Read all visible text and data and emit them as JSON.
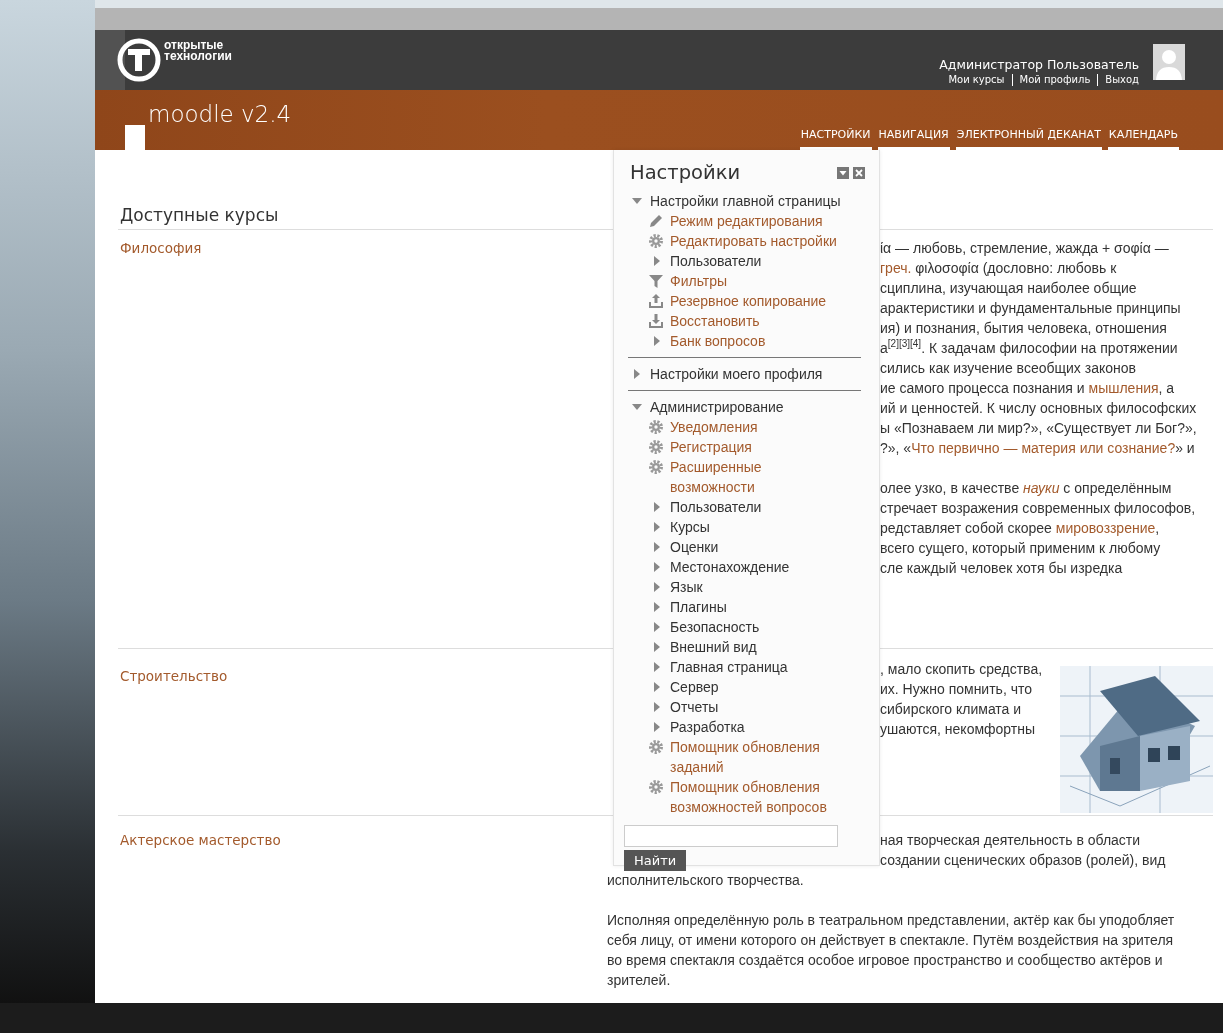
{
  "header": {
    "brand": {
      "line_1": "открытые",
      "line_2": "технологии"
    },
    "user": {
      "name": "Администратор Пользователь",
      "links": [
        "Мои курсы",
        "Мой профиль",
        "Выход"
      ]
    },
    "site_title": "moodle v2.4",
    "nav": [
      "НАСТРОЙКИ",
      "НАВИГАЦИЯ",
      "ЭЛЕКТРОННЫЙ ДЕКАНАТ",
      "КАЛЕНДАРЬ"
    ]
  },
  "courses": {
    "heading": "Доступные курсы",
    "items": [
      {
        "name": "Философия",
        "paragraphs": [
          [
            {
              "covered": true,
              "parts": [
                {
                  "text": "ία — любовь, стремление, жажда + σοφία —"
                }
              ]
            },
            {
              "covered": true,
              "parts": [
                {
                  "text": "греч.",
                  "link": true
                },
                {
                  "text": " φιλοσοφία (дословно: любовь к"
                }
              ]
            },
            {
              "covered": true,
              "parts": [
                {
                  "text": "сциплина, изучающая наиболее общие"
                }
              ]
            },
            {
              "covered": true,
              "parts": [
                {
                  "text": "арактеристики и фундаментальные принципы"
                }
              ]
            },
            {
              "covered": true,
              "parts": [
                {
                  "text": "ия) и познания, бытия человека, отношения"
                }
              ]
            },
            {
              "covered": true,
              "parts": [
                {
                  "text": "а$^{[2][3][4]}$. К задачам философии на протяжении"
                }
              ]
            },
            {
              "covered": true,
              "parts": [
                {
                  "text": "сились как изучение всеобщих законов"
                }
              ]
            },
            {
              "covered": true,
              "parts": [
                {
                  "text": "ие самого процесса познания и "
                },
                {
                  "text": "мышления",
                  "link": true
                },
                {
                  "text": ", а"
                }
              ]
            },
            {
              "covered": true,
              "parts": [
                {
                  "text": "ий и ценностей. К числу основных философских"
                }
              ]
            },
            {
              "covered": true,
              "parts": [
                {
                  "text": "ы «Познаваем ли мир?», «Существует ли Бог?»,"
                }
              ]
            },
            {
              "covered": true,
              "parts": [
                {
                  "text": "?», «"
                },
                {
                  "text": "Что первично — материя или сознание?",
                  "link": true
                },
                {
                  "text": "» и"
                }
              ]
            }
          ],
          [
            {
              "covered": true,
              "parts": [
                {
                  "text": "олее узко, в качестве "
                },
                {
                  "text": "*науки*",
                  "link": true
                },
                {
                  "text": " с определённым"
                }
              ]
            },
            {
              "covered": true,
              "parts": [
                {
                  "text": "стречает возражения современных философов,"
                }
              ]
            },
            {
              "covered": true,
              "parts": [
                {
                  "text": "редставляет собой скорее "
                },
                {
                  "text": "мировоззрение",
                  "link": true
                },
                {
                  "text": ","
                }
              ]
            },
            {
              "covered": true,
              "parts": [
                {
                  "text": "всего сущего, который применим к любому"
                }
              ]
            },
            {
              "covered": true,
              "parts": [
                {
                  "text": "сле каждый человек хотя бы изредка"
                }
              ]
            }
          ]
        ]
      },
      {
        "name": "Строительство",
        "image": {
          "kind": "picture"
        },
        "paragraphs": [
          [
            {
              "covered": true,
              "parts": [
                {
                  "text": ", мало скопить средства,"
                }
              ]
            },
            {
              "covered": true,
              "parts": [
                {
                  "text": "их. Нужно помнить, что"
                }
              ]
            },
            {
              "covered": true,
              "parts": [
                {
                  "text": "сибирского климата и"
                }
              ]
            },
            {
              "covered": true,
              "parts": [
                {
                  "text": "ушаются, некомфортны"
                }
              ]
            }
          ]
        ]
      },
      {
        "name": "Актерское мастерство",
        "paragraphs": [
          [
            {
              "covered": true,
              "parts": [
                {
                  "text": "ная творческая деятельность в области"
                }
              ]
            },
            {
              "covered": true,
              "parts": [
                {
                  "text": "создании сценических образов (ролей), вид"
                }
              ]
            },
            {
              "parts": [
                {
                  "text": "исполнительского творчества."
                }
              ]
            }
          ],
          [
            {
              "parts": [
                {
                  "text": "Исполняя определённую роль в театральном представлении, актёр как бы уподобляет"
                }
              ]
            },
            {
              "parts": [
                {
                  "text": "себя лицу, от имени которого он действует в спектакле. Путём воздействия на зрителя"
                }
              ]
            },
            {
              "parts": [
                {
                  "text": "во время спектакля создаётся особое игровое пространство и сообщество актёров и"
                }
              ]
            },
            {
              "parts": [
                {
                  "text": "зрителей."
                }
              ]
            }
          ]
        ]
      }
    ]
  },
  "settings_block": {
    "title": "Настройки",
    "tree": [
      {
        "kind": "branch",
        "label": "Настройки главной страницы",
        "expanded": true,
        "children": [
          {
            "kind": "pencil",
            "label": "Режим редактирования"
          },
          {
            "kind": "gear",
            "label": "Редактировать настройки"
          },
          {
            "kind": "branch",
            "label": "Пользователи",
            "expanded": false
          },
          {
            "kind": "filter",
            "label": "Фильтры"
          },
          {
            "kind": "upload",
            "label": "Резервное копирование"
          },
          {
            "kind": "download",
            "label": "Восстановить"
          },
          {
            "kind": "branch",
            "label": "Банк вопросов",
            "expanded": false,
            "link": true
          }
        ]
      },
      {
        "kind": "branch",
        "label": "Настройки моего профиля",
        "expanded": false
      },
      {
        "kind": "branch",
        "label": "Администрирование",
        "expanded": true,
        "children": [
          {
            "kind": "gear",
            "label": "Уведомления"
          },
          {
            "kind": "gear",
            "label": "Регистрация"
          },
          {
            "kind": "gear",
            "label": "Расширенные возможности"
          },
          {
            "kind": "branch",
            "label": "Пользователи",
            "expanded": false
          },
          {
            "kind": "branch",
            "label": "Курсы",
            "expanded": false
          },
          {
            "kind": "branch",
            "label": "Оценки",
            "expanded": false
          },
          {
            "kind": "branch",
            "label": "Местонахождение",
            "expanded": false
          },
          {
            "kind": "branch",
            "label": "Язык",
            "expanded": false
          },
          {
            "kind": "branch",
            "label": "Плагины",
            "expanded": false
          },
          {
            "kind": "branch",
            "label": "Безопасность",
            "expanded": false
          },
          {
            "kind": "branch",
            "label": "Внешний вид",
            "expanded": false
          },
          {
            "kind": "branch",
            "label": "Главная страница",
            "expanded": false
          },
          {
            "kind": "branch",
            "label": "Сервер",
            "expanded": false
          },
          {
            "kind": "branch",
            "label": "Отчеты",
            "expanded": false
          },
          {
            "kind": "branch",
            "label": "Разработка",
            "expanded": false
          },
          {
            "kind": "gear",
            "label": "Помощник обновления заданий"
          },
          {
            "kind": "gear",
            "label": "Помощник обновления возможностей вопросов"
          }
        ]
      }
    ],
    "search": {
      "button": "Найти"
    }
  }
}
